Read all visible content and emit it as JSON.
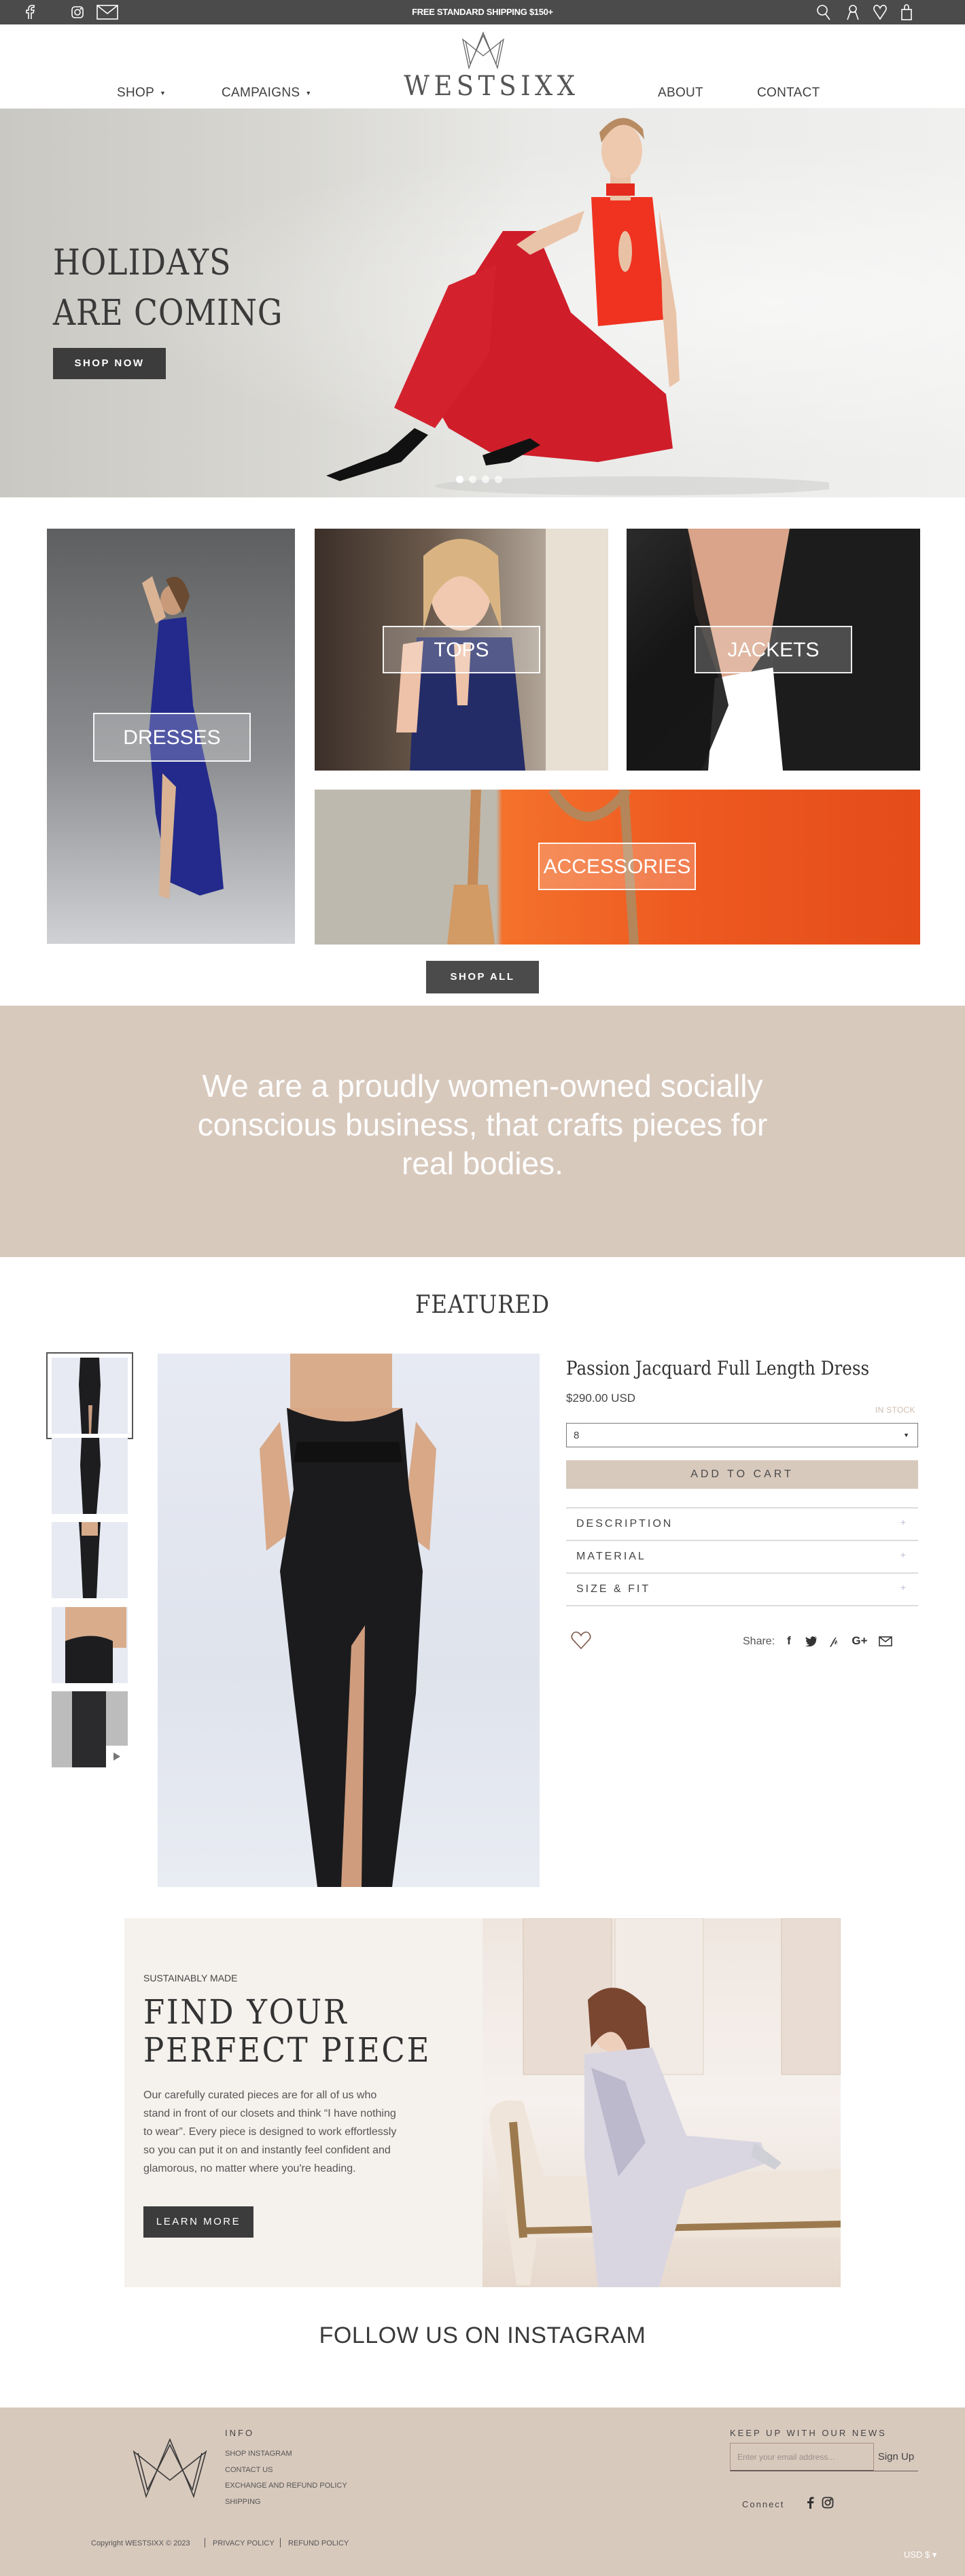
{
  "topbar": {
    "announcement": "FREE STANDARD SHIPPING $150+",
    "left_icons": [
      "facebook-icon",
      "instagram-icon",
      "mail-icon"
    ],
    "right_icons": [
      "search-icon",
      "account-icon",
      "wishlist-icon",
      "cart-icon"
    ]
  },
  "header": {
    "brand": "WESTSIXX",
    "nav_left": [
      {
        "label": "SHOP",
        "has_dropdown": true
      },
      {
        "label": "CAMPAIGNS",
        "has_dropdown": true
      }
    ],
    "nav_right": [
      {
        "label": "ABOUT"
      },
      {
        "label": "CONTACT"
      }
    ],
    "caret": "▼"
  },
  "hero": {
    "title_line1": "HOLIDAYS",
    "title_line2": "ARE COMING",
    "cta": "SHOP NOW",
    "slides": 4,
    "active_slide": 1
  },
  "categories": [
    {
      "label": "DRESSES"
    },
    {
      "label": "TOPS"
    },
    {
      "label": "JACKETS"
    },
    {
      "label": "ACCESSORIES"
    }
  ],
  "shop_all": "SHOP ALL",
  "mission": {
    "text": "We are a proudly women-owned socially conscious business, that crafts pieces for real bodies."
  },
  "featured": {
    "heading": "FEATURED",
    "thumbnails": [
      {
        "view": "front",
        "active": true
      },
      {
        "view": "front-hand-on-hip",
        "active": false
      },
      {
        "view": "back",
        "active": false
      },
      {
        "view": "bodice-side",
        "active": false
      },
      {
        "view": "video",
        "active": false,
        "is_video": true
      }
    ],
    "product": {
      "title": "Passion Jacquard Full Length Dress",
      "price": "$290.00 USD",
      "stock": "IN STOCK",
      "size_selected": "8",
      "add_to_cart": "ADD TO CART",
      "accordions": [
        "DESCRIPTION",
        "MATERIAL",
        "SIZE & FIT"
      ],
      "accordion_toggle": "+",
      "share_label": "Share:",
      "share_icons": [
        "facebook-icon",
        "twitter-icon",
        "pinterest-icon",
        "google-plus-icon",
        "email-icon"
      ]
    }
  },
  "sustainability": {
    "eyebrow": "SUSTAINABLY MADE",
    "title_line1": "FIND YOUR",
    "title_line2": "PERFECT PIECE",
    "body": "Our carefully curated pieces are for all of us who stand in front of our closets and think “I have nothing to wear”. Every piece is designed to work effortlessly so you can put it on and instantly feel confident and glamorous, no matter where you're heading.",
    "cta": "LEARN MORE"
  },
  "instagram": {
    "heading": "FOLLOW US ON INSTAGRAM"
  },
  "footer": {
    "info_heading": "INFO",
    "info_links": [
      "SHOP INSTAGRAM",
      "CONTACT US",
      "EXCHANGE AND REFUND POLICY",
      "SHIPPING"
    ],
    "news_heading": "KEEP UP WITH OUR NEWS",
    "email_placeholder": "Enter your email address...",
    "signup": "Sign Up",
    "connect": "Connect",
    "copyright": "Copyright WESTSIXX © 2023",
    "legal_links": [
      "PRIVACY POLICY",
      "REFUND POLICY"
    ],
    "currency": "USD $ ▾"
  },
  "colors": {
    "topbar": "#4b4b4b",
    "accent_beige": "#d8c9bd",
    "cream": "#f5f1ed",
    "dark_button": "#3c3c3c"
  }
}
